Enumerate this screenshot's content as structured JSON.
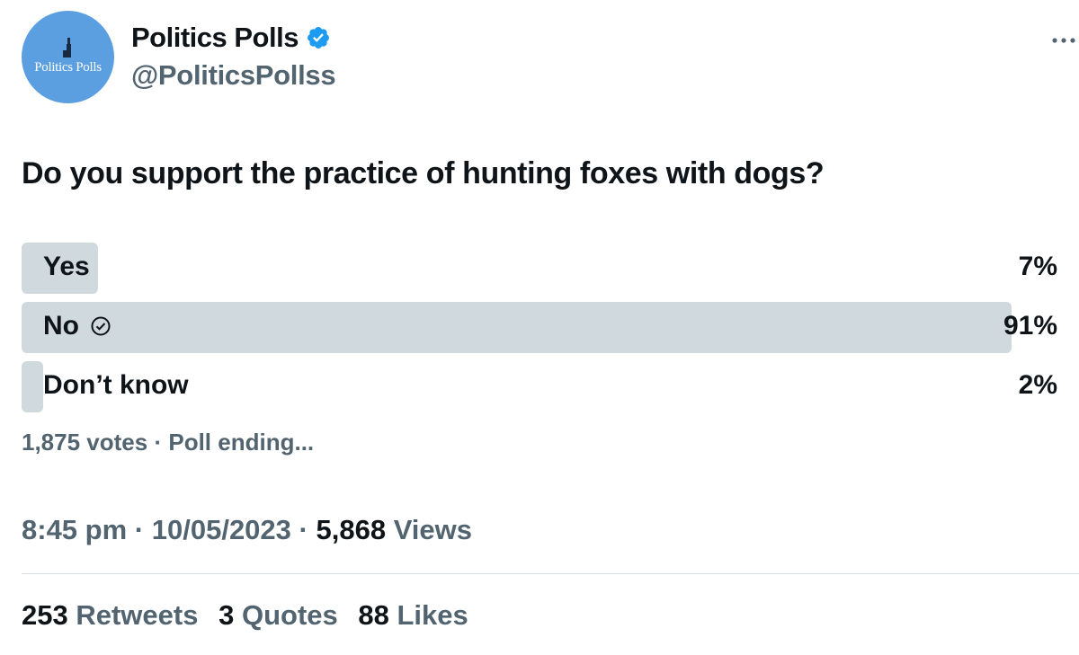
{
  "author": {
    "avatar_text": "Politics Polls",
    "display_name": "Politics Polls",
    "handle": "@PoliticsPollss",
    "verified": true
  },
  "tweet": {
    "question": "Do you support the practice of hunting foxes with dogs?"
  },
  "poll": {
    "options": [
      {
        "label": "Yes",
        "percent_text": "7%",
        "percent": 7,
        "selected": false
      },
      {
        "label": "No",
        "percent_text": "91%",
        "percent": 91,
        "selected": true
      },
      {
        "label": "Don’t know",
        "percent_text": "2%",
        "percent": 2,
        "selected": false
      }
    ],
    "votes": "1,875 votes",
    "separator": "·",
    "status": "Poll ending..."
  },
  "meta": {
    "time": "8:45 pm",
    "date": "10/05/2023",
    "views_count": "5,868",
    "views_label": "Views",
    "separator": "·"
  },
  "stats": {
    "retweets_count": "253",
    "retweets_label": "Retweets",
    "quotes_count": "3",
    "quotes_label": "Quotes",
    "likes_count": "88",
    "likes_label": "Likes"
  },
  "colors": {
    "verified_blue": "#1d9bf0",
    "avatar_blue": "#5b9fe0",
    "bar_fill": "#cfd9de",
    "secondary_text": "#536471",
    "primary_text": "#0f1419"
  },
  "icons": [
    "verified-badge-icon",
    "more-options-icon",
    "parliament-logo-icon",
    "selected-check-icon"
  ]
}
